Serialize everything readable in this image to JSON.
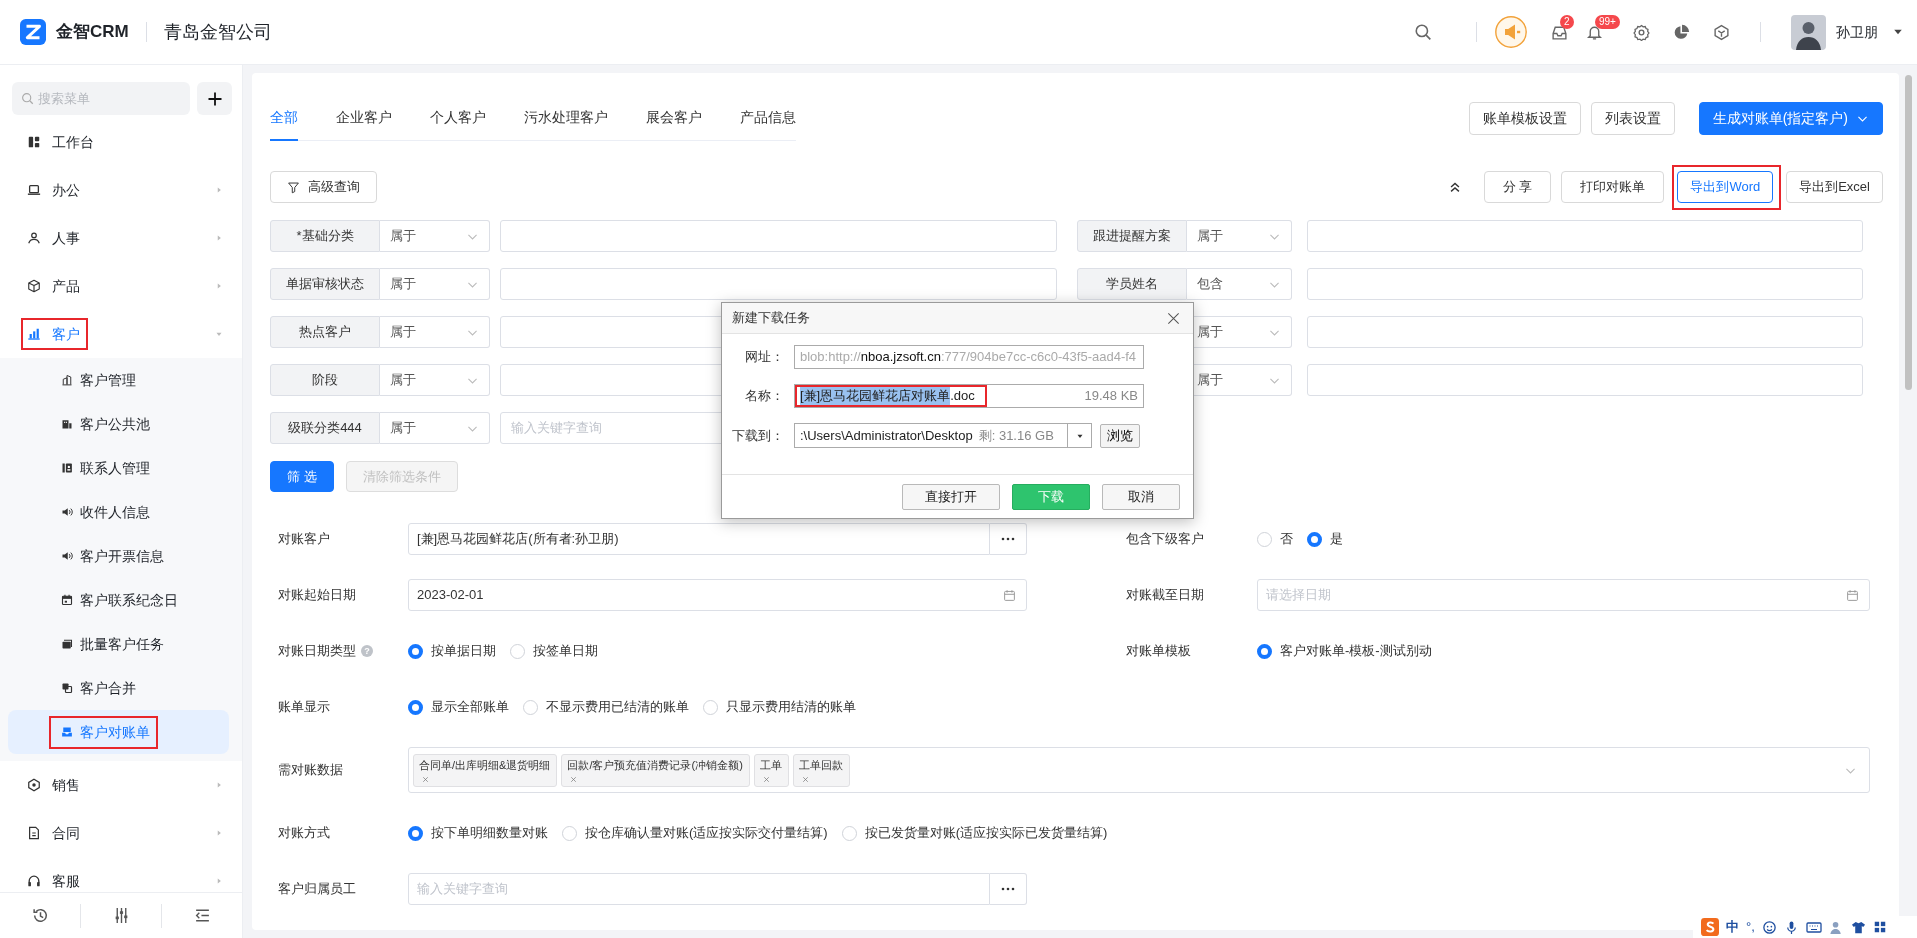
{
  "header": {
    "app_name": "金智CRM",
    "company": "青岛金智公司",
    "inbox_badge": "2",
    "bell_badge": "99+",
    "user_name": "孙卫朋"
  },
  "sidebar": {
    "search_placeholder": "搜索菜单",
    "items": [
      {
        "label": "工作台",
        "selected": false
      },
      {
        "label": "办公",
        "selected": false,
        "expanded": false
      },
      {
        "label": "人事",
        "selected": false,
        "expanded": false
      },
      {
        "label": "产品",
        "selected": false,
        "expanded": false
      },
      {
        "label": "客户",
        "selected": true,
        "expanded": true,
        "highlighted": true,
        "children": [
          {
            "label": "客户管理",
            "selected": false
          },
          {
            "label": "客户公共池",
            "selected": false
          },
          {
            "label": "联系人管理",
            "selected": false
          },
          {
            "label": "收件人信息",
            "selected": false
          },
          {
            "label": "客户开票信息",
            "selected": false
          },
          {
            "label": "客户联系纪念日",
            "selected": false
          },
          {
            "label": "批量客户任务",
            "selected": false
          },
          {
            "label": "客户合并",
            "selected": false
          },
          {
            "label": "客户对账单",
            "selected": true,
            "highlighted": true
          }
        ]
      },
      {
        "label": "销售",
        "selected": false,
        "expanded": false
      },
      {
        "label": "合同",
        "selected": false,
        "expanded": false
      },
      {
        "label": "客服",
        "selected": false,
        "expanded": false
      }
    ]
  },
  "tabs": [
    {
      "label": "全部",
      "selected": true
    },
    {
      "label": "企业客户",
      "selected": false
    },
    {
      "label": "个人客户",
      "selected": false
    },
    {
      "label": "污水处理客户",
      "selected": false
    },
    {
      "label": "展会客户",
      "selected": false
    },
    {
      "label": "产品信息",
      "selected": false
    }
  ],
  "header_buttons": [
    {
      "label": "账单模板设置",
      "kind": "default"
    },
    {
      "label": "列表设置",
      "kind": "default"
    },
    {
      "label": "生成对账单(指定客户)",
      "kind": "primary"
    }
  ],
  "toolbar": {
    "advanced_query": "高级查询",
    "actions": [
      {
        "label": "分 享",
        "active": false
      },
      {
        "label": "打印对账单",
        "active": false
      },
      {
        "label": "导出到Word",
        "active": true,
        "highlighted": true
      },
      {
        "label": "导出到Excel",
        "active": false
      }
    ]
  },
  "filters": {
    "rows": [
      {
        "left": {
          "label": "*基础分类",
          "operator": "属于"
        },
        "right": {
          "label": "跟进提醒方案",
          "operator": "属于"
        }
      },
      {
        "left": {
          "label": "单据审核状态",
          "operator": "属于"
        },
        "right": {
          "label": "学员姓名",
          "operator": "包含"
        }
      },
      {
        "left": {
          "label": "热点客户",
          "operator": "属于"
        },
        "right": {
          "operator": "属于"
        }
      },
      {
        "left": {
          "label": "阶段",
          "operator": "属于"
        },
        "right": {
          "operator": "属于"
        }
      },
      {
        "left": {
          "label": "级联分类444",
          "operator": "属于",
          "placeholder": "输入关键字查询"
        }
      }
    ]
  },
  "filter_buttons": [
    {
      "label": "筛 选",
      "kind": "primary",
      "disabled": false
    },
    {
      "label": "清除筛选条件",
      "kind": "default",
      "disabled": true
    }
  ],
  "form": {
    "rows": [
      {
        "fields": [
          {
            "label": "对账客户",
            "kind": "picker",
            "value": "[兼]恩马花园鲜花店(所有者:孙卫朋)"
          },
          {
            "label": "包含下级客户",
            "kind": "radio",
            "options": [
              {
                "label": "否",
                "selected": false
              },
              {
                "label": "是",
                "selected": true
              }
            ]
          }
        ]
      },
      {
        "fields": [
          {
            "label": "对账起始日期",
            "kind": "date",
            "value": "2023-02-01"
          },
          {
            "label": "对账截至日期",
            "kind": "date",
            "placeholder": "请选择日期"
          }
        ]
      },
      {
        "fields": [
          {
            "label": "对账日期类型",
            "kind": "radio",
            "help": "?",
            "options": [
              {
                "label": "按单据日期",
                "selected": true
              },
              {
                "label": "按签单日期",
                "selected": false
              }
            ]
          },
          {
            "label": "对账单模板",
            "kind": "radio",
            "options": [
              {
                "label": "客户对账单-模板-测试别动",
                "selected": true
              }
            ]
          }
        ]
      },
      {
        "fields": [
          {
            "label": "账单显示",
            "kind": "radio",
            "options": [
              {
                "label": "显示全部账单",
                "selected": true
              },
              {
                "label": "不显示费用已结清的账单",
                "selected": false
              },
              {
                "label": "只显示费用结清的账单",
                "selected": false
              }
            ]
          }
        ]
      },
      {
        "fields": [
          {
            "label": "需对账数据",
            "kind": "tags",
            "tags": [
              "合同单/出库明细&退货明细",
              "回款/客户预充值消费记录(冲销金额)",
              "工单",
              "工单回款"
            ]
          }
        ]
      },
      {
        "fields": [
          {
            "label": "对账方式",
            "kind": "radio",
            "options": [
              {
                "label": "按下单明细数量对账",
                "selected": true
              },
              {
                "label": "按仓库确认量对账(适应按实际交付量结算)",
                "selected": false
              },
              {
                "label": "按已发货量对账(适应按实际已发货量结算)",
                "selected": false
              }
            ]
          }
        ]
      },
      {
        "fields": [
          {
            "label": "客户归属员工",
            "kind": "picker",
            "placeholder": "输入关键字查询"
          }
        ]
      }
    ]
  },
  "download_dialog": {
    "title": "新建下载任务",
    "url_label": "网址：",
    "url_parts": [
      {
        "text": "blob:http://",
        "emphasis": false
      },
      {
        "text": "nboa.jzsoft.cn",
        "emphasis": true
      },
      {
        "text": ":777/904be7cc-c6c0-43f5-aad4-f4",
        "emphasis": false
      }
    ],
    "name_label": "名称：",
    "file_name_selected": "[兼]恩马花园鲜花店对账单",
    "file_name_rest": ".doc",
    "name_highlighted": true,
    "file_size": "19.48 KB",
    "save_label": "下载到：",
    "save_path": ":\\Users\\Administrator\\Desktop",
    "free_space": "剩: 31.16 GB",
    "browse": "浏览",
    "buttons": [
      {
        "label": "直接打开",
        "kind": "default"
      },
      {
        "label": "下载",
        "kind": "primary"
      },
      {
        "label": "取消",
        "kind": "default"
      }
    ]
  },
  "ime_toolbar": {
    "mode": "中",
    "punctuation": "°,"
  }
}
